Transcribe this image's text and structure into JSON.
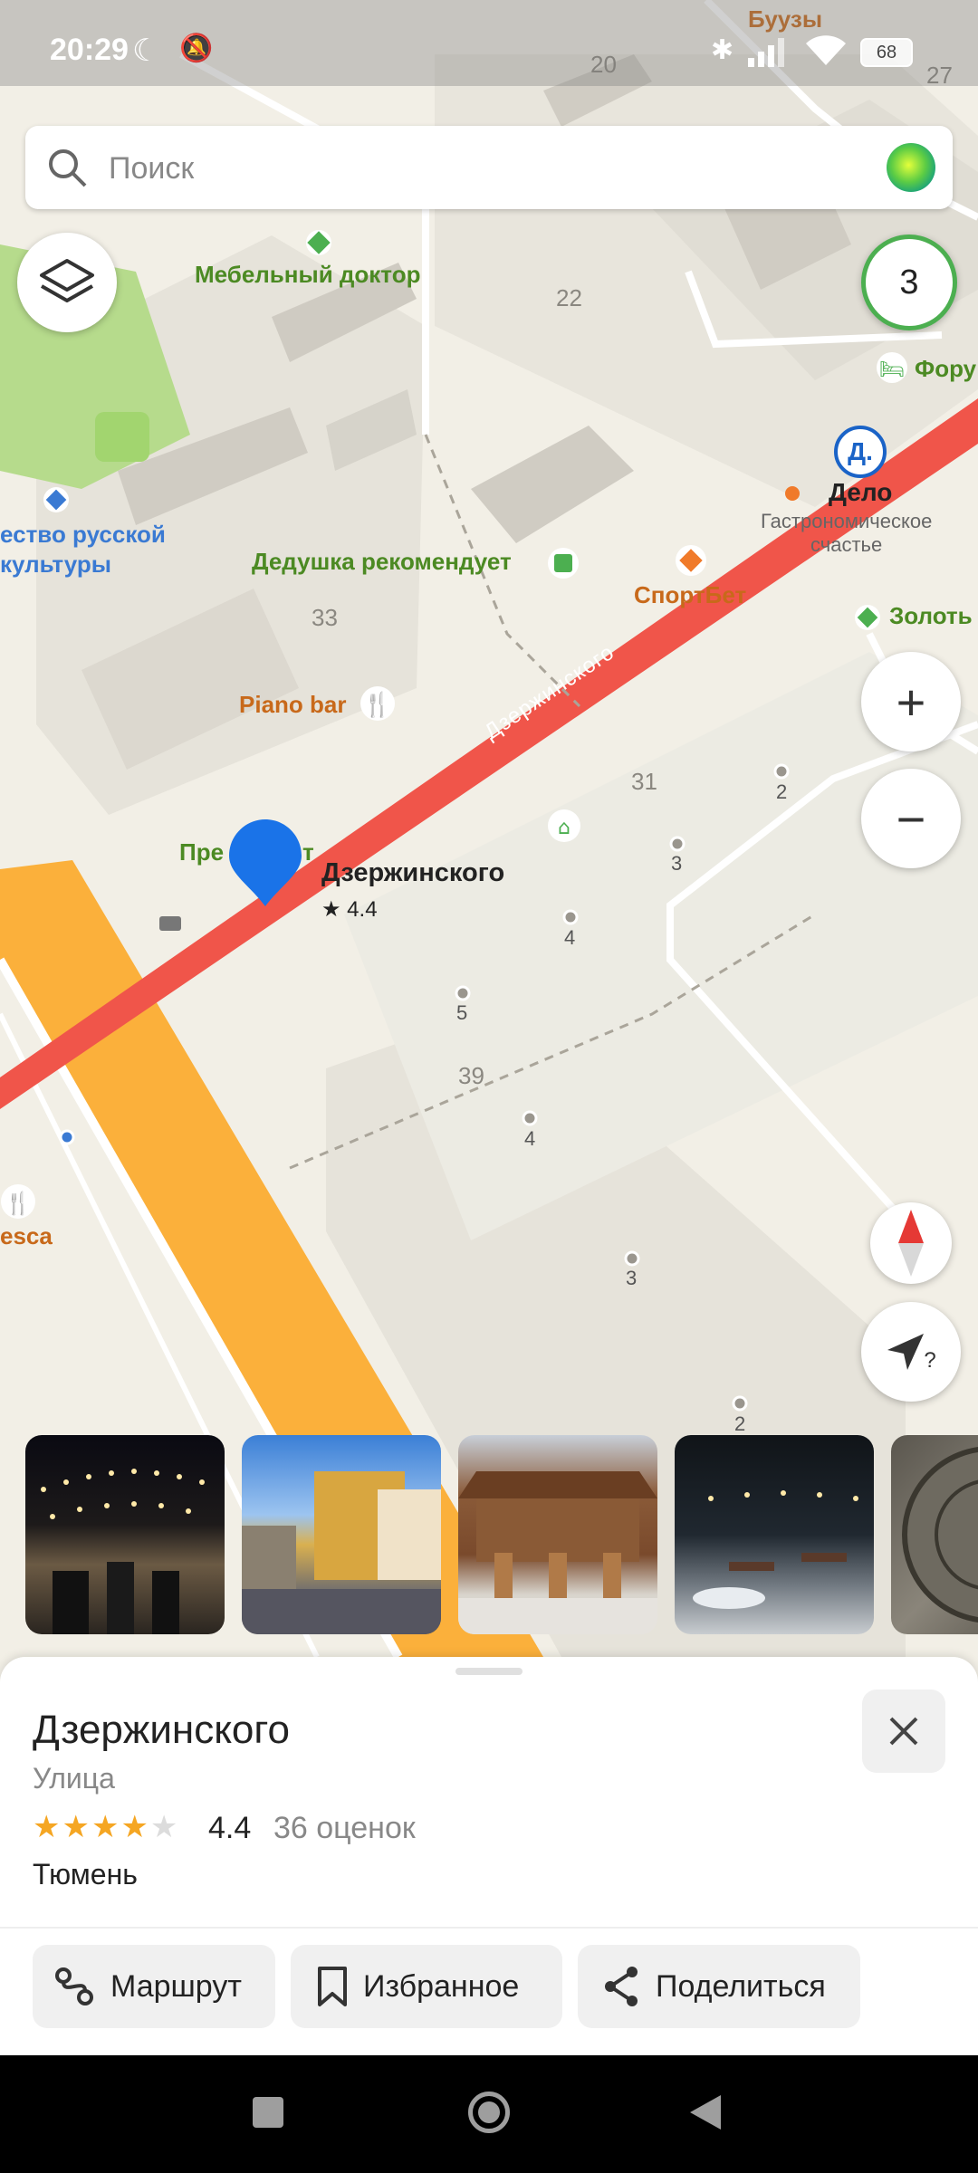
{
  "status_bar": {
    "time": "20:29",
    "battery": "68"
  },
  "search": {
    "placeholder": "Поиск"
  },
  "map_labels": {
    "street_name": "Дзержинского",
    "pin_title": "Дзержинского",
    "pin_rating": "★ 4.4",
    "pois": {
      "mebelny_doktor": "Мебельный доктор",
      "dedushka": "Дедушка рекомендует",
      "sportbet": "СпортБет",
      "piano_bar": "Piano bar",
      "delo": "Дело",
      "delo_sub": "Гастрономическое\nсчастье",
      "buuzy": "Буузы",
      "forum": "Фору",
      "zolot": "Золоть",
      "russian_culture_1": "ество русской",
      "russian_culture_2": "культуры",
      "pre": "Пре",
      "pre_t": "т",
      "esca": "esca",
      "delo_badge": "Д."
    },
    "buildings": [
      "20",
      "27",
      "22",
      "33",
      "31",
      "39"
    ],
    "entrances": [
      "2",
      "3",
      "4",
      "5",
      "4",
      "3",
      "2"
    ]
  },
  "controls": {
    "traffic_level": "3",
    "zoom_in": "+",
    "zoom_out": "−",
    "locate_hint": "?"
  },
  "place": {
    "title": "Дзержинского",
    "type": "Улица",
    "rating": "4.4",
    "stars_filled": 4,
    "stars_total": 5,
    "reviews": "36 оценок",
    "city": "Тюмень"
  },
  "actions": {
    "route": "Маршрут",
    "favorite": "Избранное",
    "share": "Поделиться"
  },
  "colors": {
    "road_red": "#f0554a",
    "road_orange": "#fbb03b",
    "pin_blue": "#1a73e8",
    "traffic_green": "#4caf50",
    "star": "#f5a623"
  }
}
